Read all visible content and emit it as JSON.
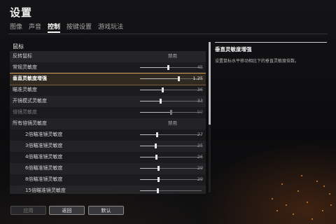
{
  "page_title": "设置",
  "tabs": [
    {
      "label": "图像",
      "active": false
    },
    {
      "label": "声音",
      "active": false
    },
    {
      "label": "控制",
      "active": true
    },
    {
      "label": "按键设置",
      "active": false
    },
    {
      "label": "游戏玩法",
      "active": false
    }
  ],
  "section": {
    "title": "鼠标"
  },
  "rows": [
    {
      "label": "反转鼠标",
      "type": "toggle",
      "text": "禁用"
    },
    {
      "label": "常规灵敏度",
      "type": "slider",
      "value": "45",
      "fraction": 0.45
    },
    {
      "label": "垂直灵敏度增强",
      "type": "slider",
      "value": "1.25",
      "fraction": 0.62,
      "selected": true
    },
    {
      "label": "瞄准灵敏度",
      "type": "slider",
      "value": "36",
      "fraction": 0.36
    },
    {
      "label": "开镜模式灵敏度",
      "type": "slider",
      "value": "33",
      "fraction": 0.33
    },
    {
      "label": "倍镜灵敏度",
      "type": "slider",
      "value": "50",
      "fraction": 0.5,
      "disabled": true
    },
    {
      "label": "所有倍镜灵敏度",
      "type": "toggle",
      "text": "禁用"
    },
    {
      "label": "2倍瞄准镜灵敏度",
      "type": "slider",
      "value": "27",
      "fraction": 0.27,
      "indent": true
    },
    {
      "label": "3倍瞄准镜灵敏度",
      "type": "slider",
      "value": "25",
      "fraction": 0.25,
      "indent": true
    },
    {
      "label": "4倍瞄准镜灵敏度",
      "type": "slider",
      "value": "26",
      "fraction": 0.26,
      "indent": true
    },
    {
      "label": "6倍瞄准镜灵敏度",
      "type": "slider",
      "value": "29",
      "fraction": 0.29,
      "indent": true
    },
    {
      "label": "8倍瞄准镜灵敏度",
      "type": "slider",
      "value": "29",
      "fraction": 0.29,
      "indent": true
    },
    {
      "label": "15倍瞄准镜灵敏度",
      "type": "slider",
      "value": "",
      "fraction": 0.28,
      "indent": true
    }
  ],
  "description": {
    "title": "垂直灵敏度增强",
    "text": "设置鼠标水平移动相比下的垂直灵敏度倍数。"
  },
  "buttons": {
    "apply": "应用",
    "back": "返回",
    "default": "默认"
  }
}
